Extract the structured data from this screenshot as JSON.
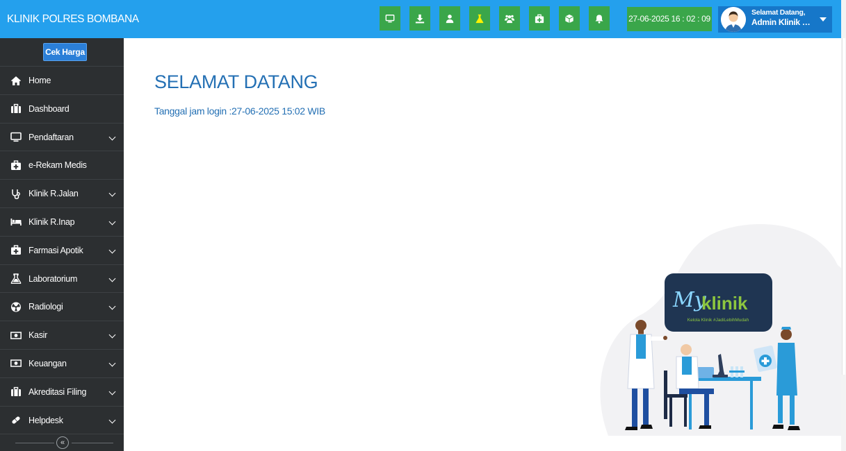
{
  "app": {
    "brand": "KLINIK POLRES BOMBANA"
  },
  "toolbar": {
    "buttons": [
      {
        "icon": "monitor-icon",
        "color": "#3aa64a"
      },
      {
        "icon": "download-icon",
        "color": "#3aa64a"
      },
      {
        "icon": "user-icon",
        "color": "#3aa64a"
      },
      {
        "icon": "flask-icon",
        "color": "#3aa64a"
      },
      {
        "icon": "users-icon",
        "color": "#3aa64a"
      },
      {
        "icon": "medkit-icon",
        "color": "#3aa64a"
      },
      {
        "icon": "cube-icon",
        "color": "#3aa64a"
      },
      {
        "icon": "bell-icon",
        "color": "#3aa64a"
      }
    ],
    "datetime": "27-06-2025 16 : 02 : 09"
  },
  "user": {
    "greeting": "Selamat Datang,",
    "name": "Admin Klinik P..."
  },
  "sidebar": {
    "cek_harga": "Cek Harga",
    "items": [
      {
        "label": "Home",
        "icon": "home-icon",
        "has_submenu": false
      },
      {
        "label": "Dashboard",
        "icon": "briefcase-icon",
        "has_submenu": false
      },
      {
        "label": "Pendaftaran",
        "icon": "monitor-icon",
        "has_submenu": true
      },
      {
        "label": "e-Rekam Medis",
        "icon": "medkit-icon",
        "has_submenu": false
      },
      {
        "label": "Klinik R.Jalan",
        "icon": "stethoscope-icon",
        "has_submenu": true
      },
      {
        "label": "Klinik R.Inap",
        "icon": "bed-icon",
        "has_submenu": true
      },
      {
        "label": "Farmasi Apotik",
        "icon": "medkit-icon",
        "has_submenu": true
      },
      {
        "label": "Laboratorium",
        "icon": "flask-icon",
        "has_submenu": true
      },
      {
        "label": "Radiologi",
        "icon": "radiation-icon",
        "has_submenu": true
      },
      {
        "label": "Kasir",
        "icon": "money-icon",
        "has_submenu": true
      },
      {
        "label": "Keuangan",
        "icon": "money-icon",
        "has_submenu": true
      },
      {
        "label": "Akreditasi Filing",
        "icon": "briefcase-icon",
        "has_submenu": true
      },
      {
        "label": "Helpdesk",
        "icon": "pills-icon",
        "has_submenu": true
      }
    ],
    "collapse_symbol": "«"
  },
  "main": {
    "title": "SELAMAT DATANG",
    "login_info": "Tanggal jam login :27-06-2025 15:02 WIB"
  },
  "illustration": {
    "logo_text": "klinik",
    "tagline": "Kelola Klinik #JadiLebihMudah"
  },
  "colors": {
    "topbar": "#24a0ed",
    "toolbar_button": "#3aa64a",
    "sidebar": "#2c2f31",
    "accent_text": "#2470b4",
    "logo_card": "#1f3552",
    "logo_green": "#8dc63f"
  }
}
